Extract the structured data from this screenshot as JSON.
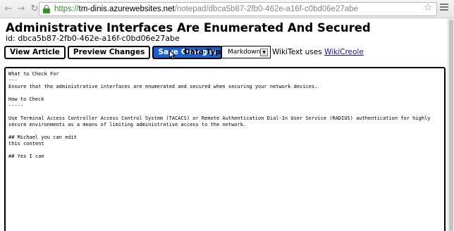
{
  "browser": {
    "url_scheme": "https://",
    "url_host": "tm-dinis.azurewebsites.net",
    "url_path": "/notepad/dbca5b87-2fb0-462e-a16f-c0bd06e27abe"
  },
  "page": {
    "title": "Administrative Interfaces Are Enumerated And Secured",
    "id_text": "id: dbca5b87-2fb0-462e-a16f-c0bd06e27abe"
  },
  "toolbar": {
    "view_label": "View Article",
    "preview_label": "Preview Changes",
    "save_label": "Save Changes",
    "data_type_label": "Data Type:",
    "data_type_value": "Markdown",
    "wikitext_prefix": "WikiText uses ",
    "wikitext_link": "WikiCreole"
  },
  "editor": {
    "lines": [
      "What to Check For",
      "---",
      "Ensure that the administrative interfaces are enumerated and secured when securing your network devices.",
      "",
      "How to Check",
      "-----",
      "",
      "Use Terminal Access Controller Access Control System (TACACS) or Remote Authentication Dial-In User Service (RADIUS) authentication for highly",
      "secure environments as a means of limiting administrative access to the network.",
      "",
      "## Michael you can edit",
      "this content",
      "",
      "## Yes I can"
    ]
  }
}
